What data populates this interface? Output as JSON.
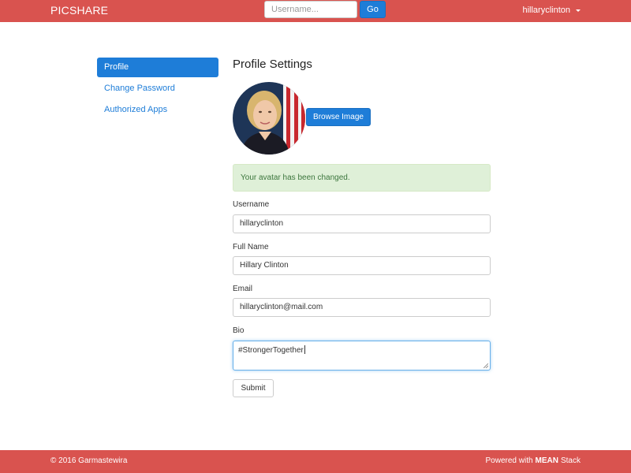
{
  "navbar": {
    "brand": "PICSHARE",
    "search_placeholder": "Username...",
    "go_label": "Go",
    "user_label": "hillaryclinton"
  },
  "sidebar": {
    "items": [
      {
        "label": "Profile",
        "active": true
      },
      {
        "label": "Change Password",
        "active": false
      },
      {
        "label": "Authorized Apps",
        "active": false
      }
    ]
  },
  "main": {
    "title": "Profile Settings",
    "browse_label": "Browse Image",
    "alert": "Your avatar has been changed.",
    "fields": {
      "username": {
        "label": "Username",
        "value": "hillaryclinton"
      },
      "full_name": {
        "label": "Full Name",
        "value": "Hillary Clinton"
      },
      "email": {
        "label": "Email",
        "value": "hillaryclinton@mail.com"
      },
      "bio": {
        "label": "Bio",
        "value": "#StrongerTogether"
      }
    },
    "submit_label": "Submit"
  },
  "footer": {
    "copyright": "© 2016 Garmastewira",
    "powered_prefix": "Powered with",
    "powered_bold": "MEAN",
    "powered_suffix": "Stack"
  },
  "colors": {
    "brand_red": "#d9534f",
    "primary_blue": "#1e7dd8",
    "success_bg": "#dff0d8",
    "success_text": "#3c763d"
  }
}
